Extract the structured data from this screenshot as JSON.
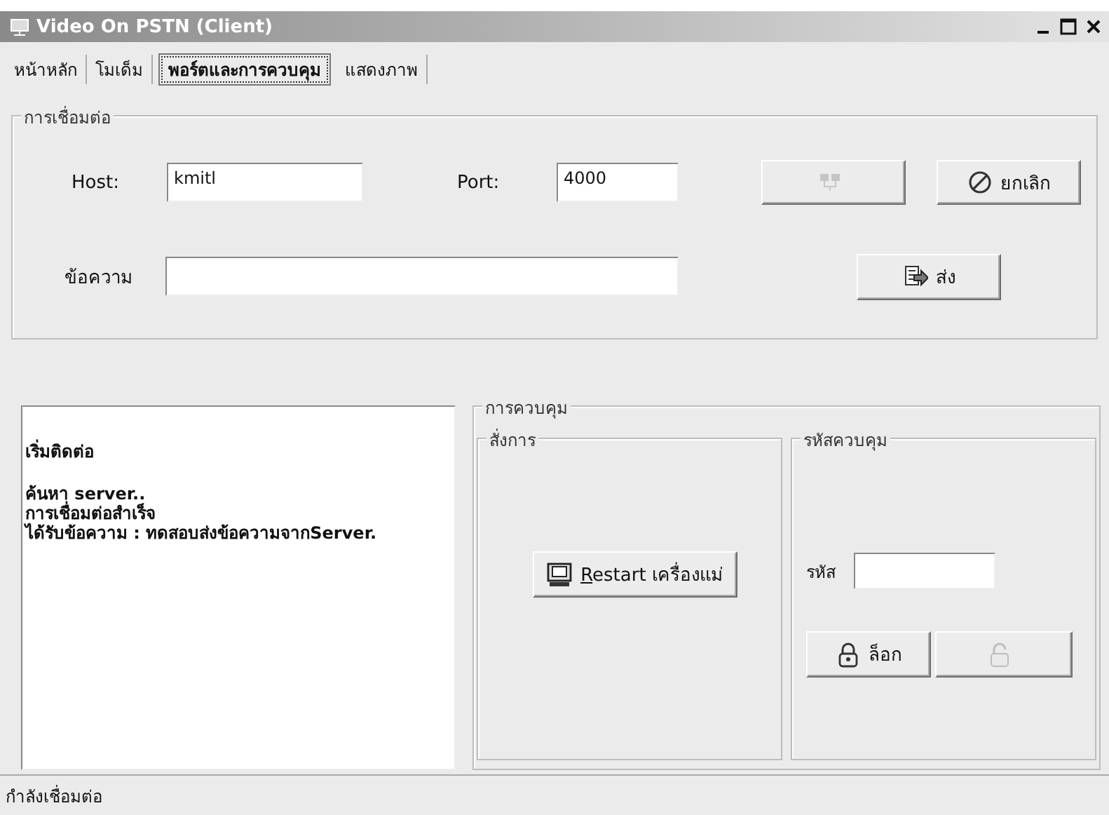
{
  "window": {
    "title": "Video On PSTN (Client)"
  },
  "tabs": [
    {
      "label": "หน้าหลัก",
      "selected": false
    },
    {
      "label": "โมเด็ม",
      "selected": false
    },
    {
      "label": "พอร์ตและการควบคุม",
      "selected": true
    },
    {
      "label": "แสดงภาพ",
      "selected": false
    }
  ],
  "connection": {
    "title": "การเชื่อมต่อ",
    "host_label": "Host:",
    "host": "kmitl",
    "port_label": "Port:",
    "port": "4000",
    "message_label": "ข้อความ",
    "buttons": [
      {
        "kind": "connect",
        "disabled": true
      },
      {
        "kind": "cancel",
        "label": "ยกเลิก",
        "disabled": false
      }
    ],
    "send_button": {
      "kind": "send",
      "label": "ส่ง",
      "disabled": false
    }
  },
  "log": {
    "paragraphs": [
      {
        "lines": [
          "เริ่มติดต่อ"
        ]
      },
      {
        "lines": [
          "ค้นหา server..",
          "การเชื่อมต่อสำเร็จ",
          "ได้รับข้อความ : ทดสอบส่งข้อความจากServer."
        ]
      }
    ]
  },
  "control": {
    "title": "การควบคุม",
    "command": {
      "title": "สั่งการ",
      "button": {
        "kind": "restart",
        "label": "Restart เครื่องแม่",
        "disabled": false
      }
    },
    "code": {
      "title": "รหัสควบคุม",
      "label": "รหัส",
      "buttons": [
        {
          "kind": "lock",
          "label": "ล็อก",
          "disabled": false
        },
        {
          "kind": "unlock",
          "disabled": true
        }
      ]
    }
  },
  "status_bar": {
    "text": "กำลังเชื่อมต่อ"
  }
}
